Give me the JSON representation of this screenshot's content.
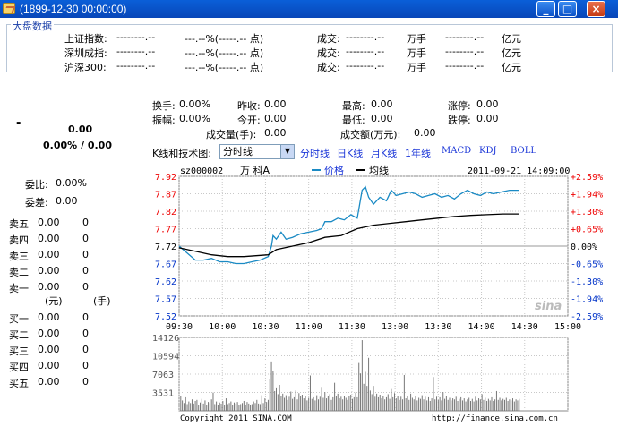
{
  "window": {
    "title": "(1899-12-30 00:00:00)",
    "min_label": "_",
    "max_label": "□",
    "close_label": "×"
  },
  "market": {
    "legend": "大盘数据",
    "rows": [
      {
        "name": "上证指数:",
        "val": "--------.--",
        "chg": "---.--%(-----.-- 点)",
        "deal_label": "成交:",
        "vol": "--------.--",
        "vol_unit": "万手",
        "amt": "--------.--",
        "amt_unit": "亿元"
      },
      {
        "name": "深圳成指:",
        "val": "--------.--",
        "chg": "---.--%(-----.-- 点)",
        "deal_label": "成交:",
        "vol": "--------.--",
        "vol_unit": "万手",
        "amt": "--------.--",
        "amt_unit": "亿元"
      },
      {
        "name": "沪深300:",
        "val": "--------.--",
        "chg": "---.--%(-----.-- 点)",
        "deal_label": "成交:",
        "vol": "--------.--",
        "vol_unit": "万手",
        "amt": "--------.--",
        "amt_unit": "亿元"
      }
    ]
  },
  "quote": {
    "dash": "-",
    "price": "0.00",
    "change": "0.00% / 0.00"
  },
  "stats": {
    "turnover_label": "换手:",
    "turnover": "0.00%",
    "prev_close_label": "昨收:",
    "prev_close": "0.00",
    "high_label": "最高:",
    "high": "0.00",
    "limit_up_label": "涨停:",
    "limit_up": "0.00",
    "amplitude_label": "振幅:",
    "amplitude": "0.00%",
    "open_label": "今开:",
    "open": "0.00",
    "low_label": "最低:",
    "low": "0.00",
    "limit_down_label": "跌停:",
    "limit_down": "0.00",
    "volume_label": "成交量(手):",
    "volume": "0.00",
    "amount_label": "成交额(万元):",
    "amount": "0.00"
  },
  "book": {
    "ratio_label": "委比:",
    "ratio": "0.00%",
    "diff_label": "委差:",
    "diff": "0.00",
    "unit_price": "(元)",
    "unit_qty": "(手)",
    "sells": [
      {
        "label": "卖五",
        "price": "0.00",
        "qty": "0"
      },
      {
        "label": "卖四",
        "price": "0.00",
        "qty": "0"
      },
      {
        "label": "卖三",
        "price": "0.00",
        "qty": "0"
      },
      {
        "label": "卖二",
        "price": "0.00",
        "qty": "0"
      },
      {
        "label": "卖一",
        "price": "0.00",
        "qty": "0"
      }
    ],
    "buys": [
      {
        "label": "买一",
        "price": "0.00",
        "qty": "0"
      },
      {
        "label": "买二",
        "price": "0.00",
        "qty": "0"
      },
      {
        "label": "买三",
        "price": "0.00",
        "qty": "0"
      },
      {
        "label": "买四",
        "price": "0.00",
        "qty": "0"
      },
      {
        "label": "买五",
        "price": "0.00",
        "qty": "0"
      }
    ]
  },
  "toolbar": {
    "label": "K线和技术图:",
    "selected": "分时线",
    "tabs": [
      "分时线",
      "日K线",
      "月K线",
      "1年线",
      "MACD",
      "KDJ",
      "BOLL"
    ]
  },
  "chart_header": {
    "code": "sz000002",
    "name": "万 科A",
    "legend_price": "价格",
    "legend_avg": "均线",
    "datetime": "2011-09-21 14:09:00",
    "watermark": "sina"
  },
  "footer": {
    "copyright": "Copyright 2011 SINA.COM",
    "url": "http://finance.sina.com.cn"
  },
  "colors": {
    "price_line": "#1a8ac4",
    "avg_line": "#000000",
    "up": "#e00000",
    "down": "#0032c8",
    "grid": "#c8c8c8"
  },
  "chart_data": {
    "type": "line",
    "x_ticks": [
      "09:30",
      "10:00",
      "10:30",
      "11:00",
      "11:30",
      "13:00",
      "13:30",
      "14:00",
      "14:30",
      "15:00"
    ],
    "y_ticks": [
      "7.92",
      "7.87",
      "7.82",
      "7.77",
      "7.72",
      "7.67",
      "7.62",
      "7.57",
      "7.52"
    ],
    "pct_ticks": [
      "+2.59%",
      "+1.94%",
      "+1.30%",
      "+0.65%",
      "0.00%",
      "-0.65%",
      "-1.30%",
      "-1.94%",
      "-2.59%"
    ],
    "ylim": [
      7.52,
      7.92
    ],
    "prev_close": 7.72,
    "series": [
      {
        "name": "价格",
        "points": [
          [
            0,
            7.72
          ],
          [
            5,
            7.7
          ],
          [
            10,
            7.68
          ],
          [
            15,
            7.68
          ],
          [
            20,
            7.685
          ],
          [
            25,
            7.675
          ],
          [
            30,
            7.675
          ],
          [
            35,
            7.67
          ],
          [
            40,
            7.67
          ],
          [
            45,
            7.675
          ],
          [
            50,
            7.68
          ],
          [
            55,
            7.69
          ],
          [
            57,
            7.72
          ],
          [
            58,
            7.75
          ],
          [
            60,
            7.74
          ],
          [
            63,
            7.76
          ],
          [
            66,
            7.74
          ],
          [
            70,
            7.745
          ],
          [
            75,
            7.755
          ],
          [
            80,
            7.76
          ],
          [
            85,
            7.765
          ],
          [
            88,
            7.77
          ],
          [
            90,
            7.79
          ],
          [
            94,
            7.79
          ],
          [
            98,
            7.8
          ],
          [
            102,
            7.795
          ],
          [
            106,
            7.81
          ],
          [
            110,
            7.8
          ],
          [
            113,
            7.88
          ],
          [
            115,
            7.89
          ],
          [
            117,
            7.86
          ],
          [
            120,
            7.84
          ],
          [
            124,
            7.86
          ],
          [
            128,
            7.85
          ],
          [
            131,
            7.88
          ],
          [
            134,
            7.865
          ],
          [
            138,
            7.87
          ],
          [
            142,
            7.875
          ],
          [
            146,
            7.87
          ],
          [
            150,
            7.86
          ],
          [
            154,
            7.865
          ],
          [
            158,
            7.87
          ],
          [
            162,
            7.86
          ],
          [
            166,
            7.865
          ],
          [
            170,
            7.855
          ],
          [
            174,
            7.87
          ],
          [
            178,
            7.88
          ],
          [
            182,
            7.87
          ],
          [
            186,
            7.865
          ],
          [
            190,
            7.875
          ],
          [
            194,
            7.87
          ],
          [
            199,
            7.875
          ],
          [
            204,
            7.88
          ],
          [
            210,
            7.88
          ]
        ]
      },
      {
        "name": "均线",
        "points": [
          [
            0,
            7.715
          ],
          [
            10,
            7.705
          ],
          [
            20,
            7.695
          ],
          [
            30,
            7.69
          ],
          [
            40,
            7.69
          ],
          [
            55,
            7.695
          ],
          [
            60,
            7.71
          ],
          [
            70,
            7.72
          ],
          [
            80,
            7.73
          ],
          [
            90,
            7.745
          ],
          [
            100,
            7.75
          ],
          [
            110,
            7.77
          ],
          [
            120,
            7.78
          ],
          [
            130,
            7.785
          ],
          [
            140,
            7.79
          ],
          [
            150,
            7.795
          ],
          [
            160,
            7.8
          ],
          [
            170,
            7.805
          ],
          [
            180,
            7.808
          ],
          [
            190,
            7.81
          ],
          [
            200,
            7.812
          ],
          [
            210,
            7.812
          ]
        ]
      }
    ],
    "volume": {
      "y_ticks": [
        "14126",
        "10594",
        "7063",
        "3531"
      ],
      "ylim": [
        0,
        14126
      ],
      "bars": [
        [
          1,
          2800
        ],
        [
          2,
          2000
        ],
        [
          3,
          1500
        ],
        [
          4,
          2600
        ],
        [
          5,
          1300
        ],
        [
          6,
          1800
        ],
        [
          7,
          1500
        ],
        [
          8,
          2200
        ],
        [
          9,
          1400
        ],
        [
          10,
          1900
        ],
        [
          11,
          2100
        ],
        [
          12,
          1200
        ],
        [
          13,
          1600
        ],
        [
          14,
          2300
        ],
        [
          15,
          1400
        ],
        [
          16,
          2000
        ],
        [
          17,
          1100
        ],
        [
          18,
          1700
        ],
        [
          19,
          1500
        ],
        [
          20,
          2200
        ],
        [
          21,
          3500
        ],
        [
          22,
          1300
        ],
        [
          23,
          1800
        ],
        [
          24,
          1200
        ],
        [
          25,
          1600
        ],
        [
          26,
          1400
        ],
        [
          27,
          1900
        ],
        [
          28,
          1100
        ],
        [
          29,
          2400
        ],
        [
          30,
          1300
        ],
        [
          31,
          1500
        ],
        [
          32,
          1800
        ],
        [
          33,
          1200
        ],
        [
          34,
          1600
        ],
        [
          35,
          1400
        ],
        [
          36,
          1700
        ],
        [
          37,
          1100
        ],
        [
          38,
          1300
        ],
        [
          39,
          1500
        ],
        [
          40,
          1900
        ],
        [
          41,
          1200
        ],
        [
          42,
          1700
        ],
        [
          43,
          1400
        ],
        [
          44,
          1200
        ],
        [
          45,
          1300
        ],
        [
          46,
          1800
        ],
        [
          47,
          1500
        ],
        [
          48,
          2100
        ],
        [
          49,
          1400
        ],
        [
          50,
          1300
        ],
        [
          51,
          3000
        ],
        [
          52,
          1500
        ],
        [
          53,
          2400
        ],
        [
          54,
          1700
        ],
        [
          55,
          2100
        ],
        [
          56,
          6200
        ],
        [
          57,
          9500
        ],
        [
          58,
          7600
        ],
        [
          59,
          3800
        ],
        [
          60,
          4500
        ],
        [
          61,
          3200
        ],
        [
          62,
          5000
        ],
        [
          63,
          2800
        ],
        [
          64,
          3300
        ],
        [
          65,
          2500
        ],
        [
          66,
          3000
        ],
        [
          67,
          2100
        ],
        [
          68,
          2700
        ],
        [
          69,
          3700
        ],
        [
          70,
          2300
        ],
        [
          71,
          2600
        ],
        [
          72,
          3900
        ],
        [
          73,
          2200
        ],
        [
          74,
          3400
        ],
        [
          75,
          2800
        ],
        [
          76,
          3100
        ],
        [
          77,
          2400
        ],
        [
          78,
          2900
        ],
        [
          79,
          2000
        ],
        [
          80,
          2500
        ],
        [
          81,
          6800
        ],
        [
          82,
          2300
        ],
        [
          83,
          2600
        ],
        [
          84,
          2000
        ],
        [
          85,
          3000
        ],
        [
          86,
          2200
        ],
        [
          87,
          2700
        ],
        [
          88,
          4600
        ],
        [
          89,
          2500
        ],
        [
          90,
          3600
        ],
        [
          91,
          2400
        ],
        [
          92,
          2800
        ],
        [
          93,
          3200
        ],
        [
          94,
          2100
        ],
        [
          95,
          2600
        ],
        [
          96,
          5400
        ],
        [
          97,
          2900
        ],
        [
          98,
          3300
        ],
        [
          99,
          2400
        ],
        [
          100,
          2700
        ],
        [
          101,
          2200
        ],
        [
          102,
          2900
        ],
        [
          103,
          2500
        ],
        [
          104,
          2100
        ],
        [
          105,
          2800
        ],
        [
          106,
          3100
        ],
        [
          107,
          2300
        ],
        [
          108,
          2600
        ],
        [
          109,
          3500
        ],
        [
          110,
          2600
        ],
        [
          111,
          9200
        ],
        [
          112,
          7200
        ],
        [
          113,
          13600
        ],
        [
          114,
          5200
        ],
        [
          115,
          7500
        ],
        [
          116,
          4800
        ],
        [
          117,
          10200
        ],
        [
          118,
          3900
        ],
        [
          119,
          3200
        ],
        [
          120,
          4800
        ],
        [
          121,
          2700
        ],
        [
          122,
          3300
        ],
        [
          123,
          2600
        ],
        [
          124,
          3100
        ],
        [
          125,
          2400
        ],
        [
          126,
          2900
        ],
        [
          127,
          2200
        ],
        [
          128,
          2600
        ],
        [
          129,
          3200
        ],
        [
          130,
          2300
        ],
        [
          131,
          4200
        ],
        [
          132,
          2600
        ],
        [
          133,
          3400
        ],
        [
          134,
          2400
        ],
        [
          135,
          2900
        ],
        [
          136,
          2100
        ],
        [
          137,
          2700
        ],
        [
          138,
          2200
        ],
        [
          139,
          6900
        ],
        [
          140,
          2400
        ],
        [
          141,
          2800
        ],
        [
          142,
          2100
        ],
        [
          143,
          3300
        ],
        [
          144,
          2500
        ],
        [
          145,
          2200
        ],
        [
          146,
          2800
        ],
        [
          147,
          2000
        ],
        [
          148,
          2500
        ],
        [
          149,
          2300
        ],
        [
          150,
          3000
        ],
        [
          151,
          2200
        ],
        [
          152,
          2700
        ],
        [
          153,
          2000
        ],
        [
          154,
          2600
        ],
        [
          155,
          1900
        ],
        [
          156,
          2400
        ],
        [
          157,
          6500
        ],
        [
          158,
          2200
        ],
        [
          159,
          2700
        ],
        [
          160,
          2100
        ],
        [
          161,
          2600
        ],
        [
          162,
          2000
        ],
        [
          163,
          3600
        ],
        [
          164,
          2300
        ],
        [
          165,
          2800
        ],
        [
          166,
          2100
        ],
        [
          167,
          2500
        ],
        [
          168,
          2000
        ],
        [
          169,
          2400
        ],
        [
          170,
          2200
        ],
        [
          171,
          2700
        ],
        [
          172,
          1900
        ],
        [
          173,
          2300
        ],
        [
          174,
          2600
        ],
        [
          175,
          2000
        ],
        [
          176,
          2400
        ],
        [
          177,
          1800
        ],
        [
          178,
          2200
        ],
        [
          179,
          2500
        ],
        [
          180,
          1900
        ],
        [
          181,
          2300
        ],
        [
          182,
          1800
        ],
        [
          183,
          2700
        ],
        [
          184,
          2000
        ],
        [
          185,
          2400
        ],
        [
          186,
          2200
        ],
        [
          187,
          3200
        ],
        [
          188,
          2100
        ],
        [
          189,
          2500
        ],
        [
          190,
          1900
        ],
        [
          191,
          2300
        ],
        [
          192,
          2000
        ],
        [
          193,
          2600
        ],
        [
          194,
          1900
        ],
        [
          195,
          2200
        ],
        [
          196,
          3800
        ],
        [
          197,
          2100
        ],
        [
          198,
          2500
        ],
        [
          199,
          2000
        ],
        [
          200,
          2300
        ],
        [
          201,
          2100
        ],
        [
          202,
          2500
        ],
        [
          203,
          1900
        ],
        [
          204,
          2200
        ],
        [
          205,
          2000
        ],
        [
          206,
          2400
        ],
        [
          207,
          1800
        ],
        [
          208,
          2200
        ],
        [
          209,
          2000
        ],
        [
          210,
          2300
        ]
      ]
    }
  }
}
